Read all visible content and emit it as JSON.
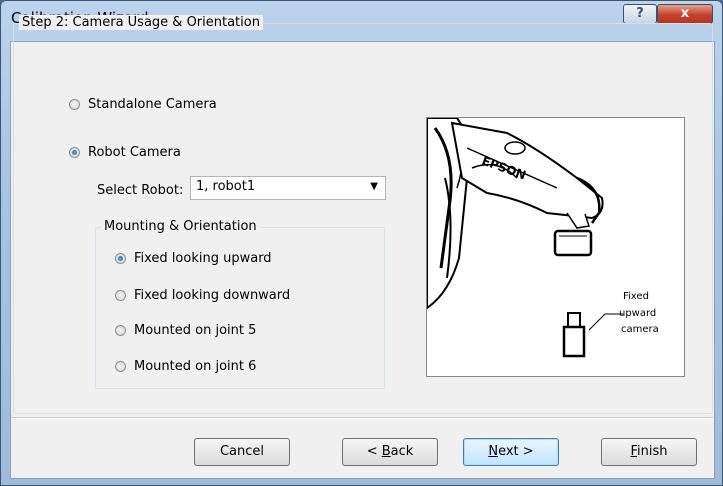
{
  "window": {
    "title": "Calibration Wizard"
  },
  "titlebar": {
    "help_label": "?",
    "close_label": "x"
  },
  "step_group": {
    "label": "Step 2: Camera Usage & Orientation"
  },
  "camera_type": {
    "standalone": {
      "label": "Standalone Camera",
      "selected": false
    },
    "robot": {
      "label": "Robot Camera",
      "selected": true
    }
  },
  "select_robot": {
    "label": "Select Robot:",
    "value": "1, robot1"
  },
  "mounting": {
    "label": "Mounting & Orientation",
    "options": [
      {
        "label": "Fixed looking upward",
        "selected": true
      },
      {
        "label": "Fixed looking downward",
        "selected": false
      },
      {
        "label": "Mounted on joint 5",
        "selected": false
      },
      {
        "label": "Mounted on joint 6",
        "selected": false
      }
    ]
  },
  "illustration": {
    "brand": "EPSON",
    "caption_lines": [
      "Fixed",
      "upward",
      "camera"
    ]
  },
  "buttons": {
    "cancel": "Cancel",
    "back_prefix": "< ",
    "back_acc": "B",
    "back_rest": "ack",
    "next_acc": "N",
    "next_rest": "ext >",
    "finish_acc": "F",
    "finish_rest": "inish"
  }
}
